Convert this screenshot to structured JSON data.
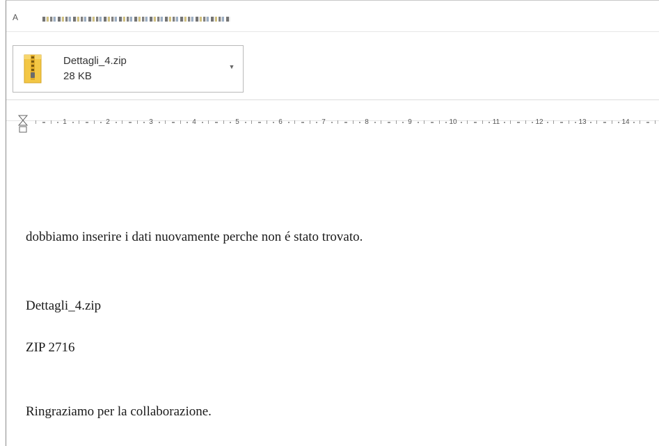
{
  "header": {
    "to_label": "A"
  },
  "attachment": {
    "file_name": "Dettagli_4.zip",
    "file_size": "28 KB",
    "icon": "zip-folder-icon"
  },
  "ruler": {
    "numbers": [
      "1",
      "2",
      "3",
      "4",
      "5",
      "6",
      "7",
      "8",
      "9",
      "10",
      "11",
      "12",
      "13",
      "14"
    ]
  },
  "message": {
    "line1": "dobbiamo inserire i dati nuovamente perche non é stato trovato.",
    "line2": "Dettagli_4.zip",
    "line3": "ZIP 2716",
    "line4": "Ringraziamo per la collaborazione."
  },
  "colors": {
    "zip_yellow": "#f3c745",
    "border": "#b9b9b9"
  }
}
